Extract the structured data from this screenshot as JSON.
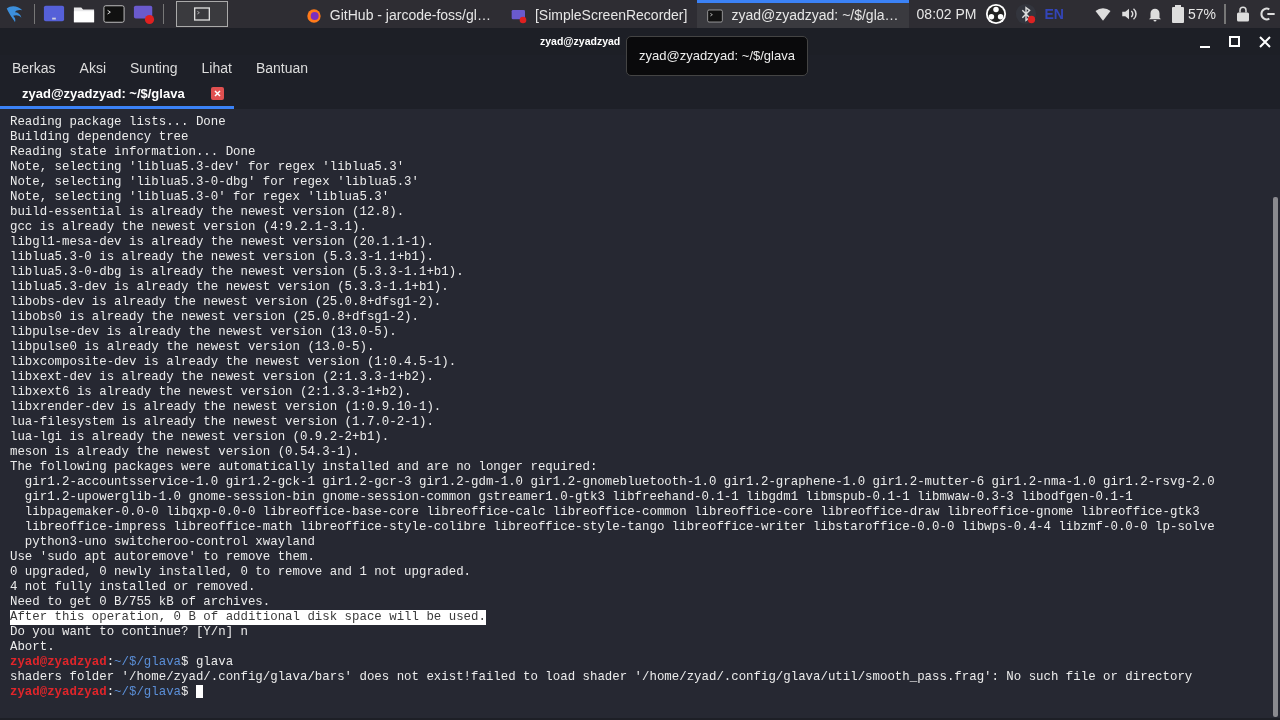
{
  "taskbar": {
    "launchers": [
      {
        "kind": "menu"
      },
      {
        "kind": "desktop"
      },
      {
        "kind": "files"
      },
      {
        "kind": "terminal"
      },
      {
        "kind": "recorder"
      }
    ],
    "workspace_button": {
      "kind": "terminal"
    },
    "tasks": [
      {
        "kind": "browser",
        "title": "GitHub - jarcode-foss/gl…",
        "selected": false
      },
      {
        "kind": "recorder",
        "title": "[SimpleScreenRecorder]",
        "selected": false
      },
      {
        "kind": "terminal",
        "title": "zyad@zyadzyad: ~/$/gla…",
        "selected": true
      }
    ],
    "clock": "08:02 PM",
    "keyboard": "EN",
    "battery": "57%"
  },
  "window": {
    "title": "zyad@zyadzyad",
    "tooltip": "zyad@zyadzyad: ~/$/glava",
    "menu": [
      "Berkas",
      "Aksi",
      "Sunting",
      "Lihat",
      "Bantuan"
    ],
    "tabs": [
      {
        "title": "zyad@zyadzyad: ~/$/glava",
        "selected": true
      }
    ]
  },
  "terminal": {
    "lines": [
      {
        "kind": "text",
        "text": "Reading package lists... Done"
      },
      {
        "kind": "text",
        "text": "Building dependency tree"
      },
      {
        "kind": "text",
        "text": "Reading state information... Done"
      },
      {
        "kind": "text",
        "text": "Note, selecting 'liblua5.3-dev' for regex 'liblua5.3'"
      },
      {
        "kind": "text",
        "text": "Note, selecting 'liblua5.3-0-dbg' for regex 'liblua5.3'"
      },
      {
        "kind": "text",
        "text": "Note, selecting 'liblua5.3-0' for regex 'liblua5.3'"
      },
      {
        "kind": "text",
        "text": "build-essential is already the newest version (12.8)."
      },
      {
        "kind": "text",
        "text": "gcc is already the newest version (4:9.2.1-3.1)."
      },
      {
        "kind": "text",
        "text": "libgl1-mesa-dev is already the newest version (20.1.1-1)."
      },
      {
        "kind": "text",
        "text": "liblua5.3-0 is already the newest version (5.3.3-1.1+b1)."
      },
      {
        "kind": "text",
        "text": "liblua5.3-0-dbg is already the newest version (5.3.3-1.1+b1)."
      },
      {
        "kind": "text",
        "text": "liblua5.3-dev is already the newest version (5.3.3-1.1+b1)."
      },
      {
        "kind": "text",
        "text": "libobs-dev is already the newest version (25.0.8+dfsg1-2)."
      },
      {
        "kind": "text",
        "text": "libobs0 is already the newest version (25.0.8+dfsg1-2)."
      },
      {
        "kind": "text",
        "text": "libpulse-dev is already the newest version (13.0-5)."
      },
      {
        "kind": "text",
        "text": "libpulse0 is already the newest version (13.0-5)."
      },
      {
        "kind": "text",
        "text": "libxcomposite-dev is already the newest version (1:0.4.5-1)."
      },
      {
        "kind": "text",
        "text": "libxext-dev is already the newest version (2:1.3.3-1+b2)."
      },
      {
        "kind": "text",
        "text": "libxext6 is already the newest version (2:1.3.3-1+b2)."
      },
      {
        "kind": "text",
        "text": "libxrender-dev is already the newest version (1:0.9.10-1)."
      },
      {
        "kind": "text",
        "text": "lua-filesystem is already the newest version (1.7.0-2-1)."
      },
      {
        "kind": "text",
        "text": "lua-lgi is already the newest version (0.9.2-2+b1)."
      },
      {
        "kind": "text",
        "text": "meson is already the newest version (0.54.3-1)."
      },
      {
        "kind": "text",
        "text": "The following packages were automatically installed and are no longer required:"
      },
      {
        "kind": "text",
        "text": "  gir1.2-accountsservice-1.0 gir1.2-gck-1 gir1.2-gcr-3 gir1.2-gdm-1.0 gir1.2-gnomebluetooth-1.0 gir1.2-graphene-1.0 gir1.2-mutter-6 gir1.2-nma-1.0 gir1.2-rsvg-2.0"
      },
      {
        "kind": "text",
        "text": "  gir1.2-upowerglib-1.0 gnome-session-bin gnome-session-common gstreamer1.0-gtk3 libfreehand-0.1-1 libgdm1 libmspub-0.1-1 libmwaw-0.3-3 libodfgen-0.1-1"
      },
      {
        "kind": "text",
        "text": "  libpagemaker-0.0-0 libqxp-0.0-0 libreoffice-base-core libreoffice-calc libreoffice-common libreoffice-core libreoffice-draw libreoffice-gnome libreoffice-gtk3"
      },
      {
        "kind": "text",
        "text": "  libreoffice-impress libreoffice-math libreoffice-style-colibre libreoffice-style-tango libreoffice-writer libstaroffice-0.0-0 libwps-0.4-4 libzmf-0.0-0 lp-solve"
      },
      {
        "kind": "text",
        "text": "  python3-uno switcheroo-control xwayland"
      },
      {
        "kind": "text",
        "text": "Use 'sudo apt autoremove' to remove them."
      },
      {
        "kind": "text",
        "text": "0 upgraded, 0 newly installed, 0 to remove and 1 not upgraded."
      },
      {
        "kind": "text",
        "text": "4 not fully installed or removed."
      },
      {
        "kind": "text",
        "text": "Need to get 0 B/755 kB of archives."
      },
      {
        "kind": "highlight",
        "text": "After this operation, 0 B of additional disk space will be used."
      },
      {
        "kind": "text",
        "text": "Do you want to continue? [Y/n] n"
      },
      {
        "kind": "text",
        "text": "Abort."
      },
      {
        "kind": "prompt",
        "user": "zyad@zyadzyad",
        "separator": ":",
        "path": "~/$/glava",
        "symbol": "$",
        "command": " glava"
      },
      {
        "kind": "text",
        "text": "shaders folder '/home/zyad/.config/glava/bars' does not exist!failed to load shader '/home/zyad/.config/glava/util/smooth_pass.frag': No such file or directory"
      },
      {
        "kind": "prompt",
        "user": "zyad@zyadzyad",
        "separator": ":",
        "path": "~/$/glava",
        "symbol": "$",
        "cursor": true
      }
    ]
  }
}
